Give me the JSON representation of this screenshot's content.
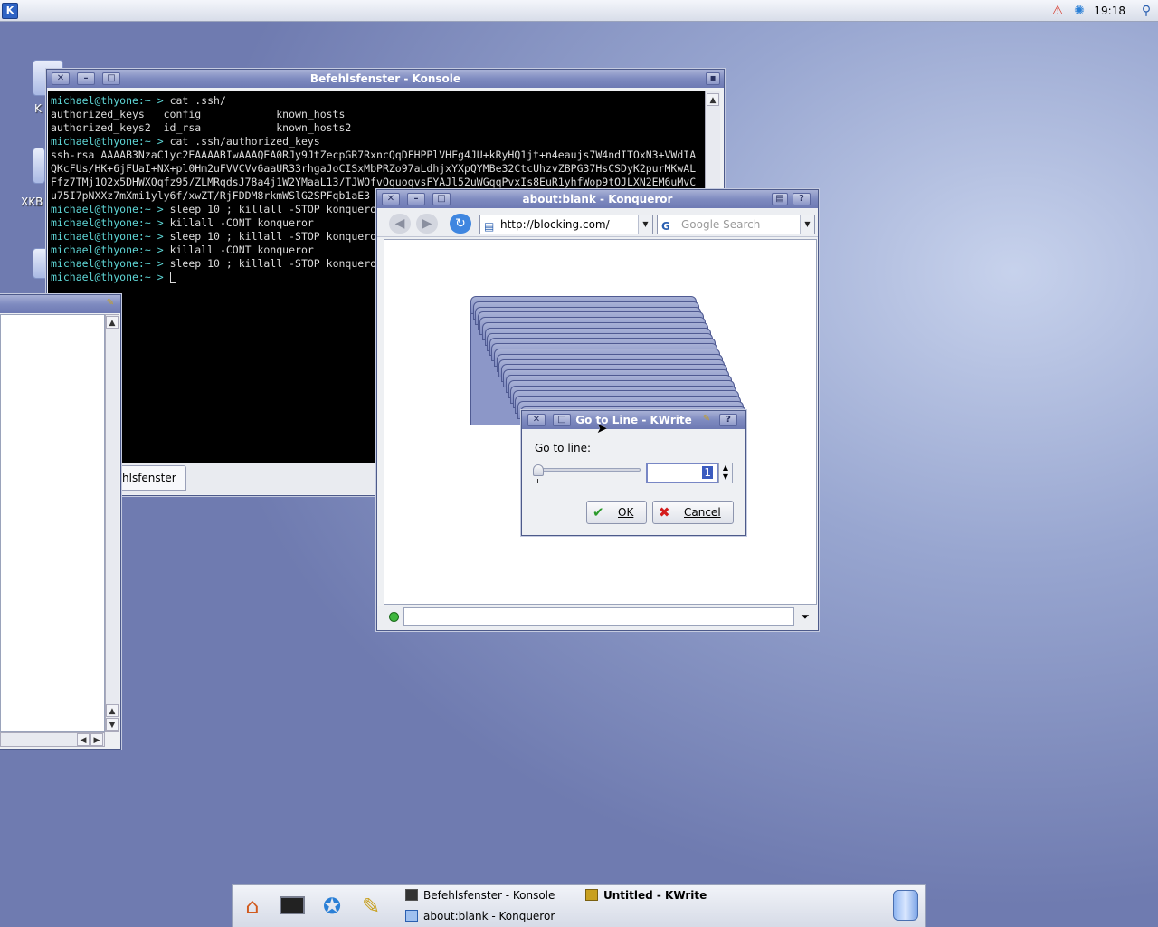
{
  "top_panel": {
    "kmenu_icon": "kde-k-menu-icon",
    "clock": "19:18",
    "tray_icons": [
      "warning-icon",
      "network-icon",
      "search-icon"
    ]
  },
  "desktop": {
    "icons": [
      {
        "label": "K"
      },
      {
        "label": "XKB"
      },
      {
        "label": ""
      }
    ]
  },
  "konsole": {
    "title": "Befehlsfenster - Konsole",
    "terminal_lines": [
      {
        "prompt": "michael@thyone:~ > ",
        "text": "cat .ssh/"
      },
      {
        "prompt": "",
        "text": "authorized_keys   config            known_hosts"
      },
      {
        "prompt": "",
        "text": "authorized_keys2  id_rsa            known_hosts2"
      },
      {
        "prompt": "michael@thyone:~ > ",
        "text": "cat .ssh/authorized_keys"
      },
      {
        "prompt": "",
        "text": "ssh-rsa AAAAB3NzaC1yc2EAAAABIwAAAQEA0RJy9JtZecpGR7RxncQqDFHPPlVHFg4JU+kRyHQ1jt+n4eaujs7W4ndITOxN3+VWdIA"
      },
      {
        "prompt": "",
        "text": "QKcFUs/HK+6jFUaI+NX+pl0Hm2uFVVCVv6aaUR33rhgaJoCISxMbPRZo97aLdhjxYXpQYMBe32CtcUhzvZBPG37HsCSDyK2purMKwAL"
      },
      {
        "prompt": "",
        "text": "Ffz7TMj1O2x5DHWXQqfz95/ZLMRqdsJ78a4j1W2YMaaL13/TJWOfvOquoqvsFYAJl52uWGqqPvxIs8EuR1yhfWop9tOJLXN2EM6uMvC"
      },
      {
        "prompt": "",
        "text": "u75I7pNXXz7mXmi1yly6f/xwZT/RjFDDM8rkmWSlG2SPFqb1aE3"
      },
      {
        "prompt": "michael@thyone:~ > ",
        "text": "sleep 10 ; killall -STOP konqueror"
      },
      {
        "prompt": "michael@thyone:~ > ",
        "text": "killall -CONT konqueror"
      },
      {
        "prompt": "michael@thyone:~ > ",
        "text": "sleep 10 ; killall -STOP konqueror"
      },
      {
        "prompt": "michael@thyone:~ > ",
        "text": "killall -CONT konqueror"
      },
      {
        "prompt": "michael@thyone:~ > ",
        "text": "sleep 10 ; killall -STOP konqueror"
      },
      {
        "prompt": "michael@thyone:~ > ",
        "text": ""
      }
    ],
    "tab_label": "hlsfenster"
  },
  "konqueror": {
    "title": "about:blank - Konqueror",
    "url": "http://blocking.com/",
    "search_placeholder": "Google Search"
  },
  "goto_dialog": {
    "title": "Go to Line - KWrite",
    "label": "Go to line:",
    "line_value": "1",
    "ok_label": "OK",
    "cancel_label": "Cancel"
  },
  "taskbar": {
    "quick_launch": [
      "home-icon",
      "terminal-icon",
      "browser-icon",
      "kwrite-icon"
    ],
    "tasks": [
      {
        "label": "Befehlsfenster - Konsole",
        "active": false
      },
      {
        "label": "Untitled - KWrite",
        "active": true
      },
      {
        "label": "about:blank - Konqueror",
        "active": false
      }
    ]
  }
}
